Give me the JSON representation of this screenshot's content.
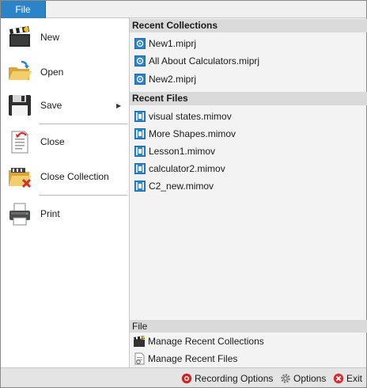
{
  "file_tab": "File",
  "menu": {
    "new": "New",
    "open": "Open",
    "save": "Save",
    "close": "Close",
    "close_collection": "Close Collection",
    "print": "Print"
  },
  "recent_collections": {
    "title": "Recent Collections",
    "items": [
      "New1.miprj",
      "All About Calculators.miprj",
      "New2.miprj"
    ]
  },
  "recent_files": {
    "title": "Recent Files",
    "items": [
      "visual states.mimov",
      "More Shapes.mimov",
      "Lesson1.mimov",
      "calculator2.mimov",
      "C2_new.mimov"
    ]
  },
  "file_section": {
    "title": "File",
    "manage_collections": "Manage Recent Collections",
    "manage_files": "Manage Recent Files"
  },
  "status": {
    "recording_options": "Recording Options",
    "options": "Options",
    "exit": "Exit"
  },
  "colors": {
    "accent": "#2b83c8",
    "pane": "#f3f3f3",
    "section_header": "#dadada"
  }
}
